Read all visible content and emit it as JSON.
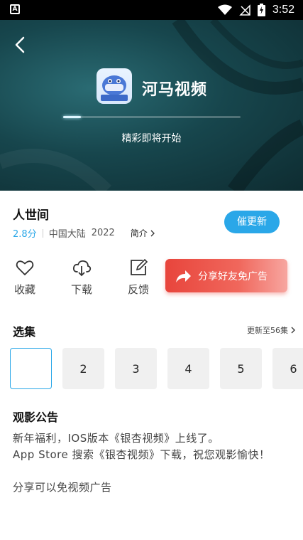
{
  "status_bar": {
    "time": "3:52",
    "left_icon": "A"
  },
  "player": {
    "app_name": "河马视频",
    "loading_text": "精彩即将开始",
    "progress": 0.1
  },
  "show": {
    "title": "人世间",
    "score": "2.8分",
    "region": "中国大陆",
    "year": "2022",
    "intro_label": "简介",
    "urge_label": "催更新"
  },
  "actions": {
    "favorite": "收藏",
    "download": "下载",
    "feedback": "反馈",
    "share": "分享好友免广告"
  },
  "episodes": {
    "title": "选集",
    "more_label": "更新至56集",
    "items": [
      "",
      "2",
      "3",
      "4",
      "5",
      "6"
    ]
  },
  "notice": {
    "title": "观影公告",
    "text": "新年福利，IOS版本《银杏视频》上线了。\nApp Store 搜索《银杏视频》下载，祝您观影愉快！\n\n分享可以免视频广告"
  },
  "colors": {
    "accent": "#2aa7e8",
    "share_red": "#e8453c",
    "player_bg": "#17464d"
  }
}
